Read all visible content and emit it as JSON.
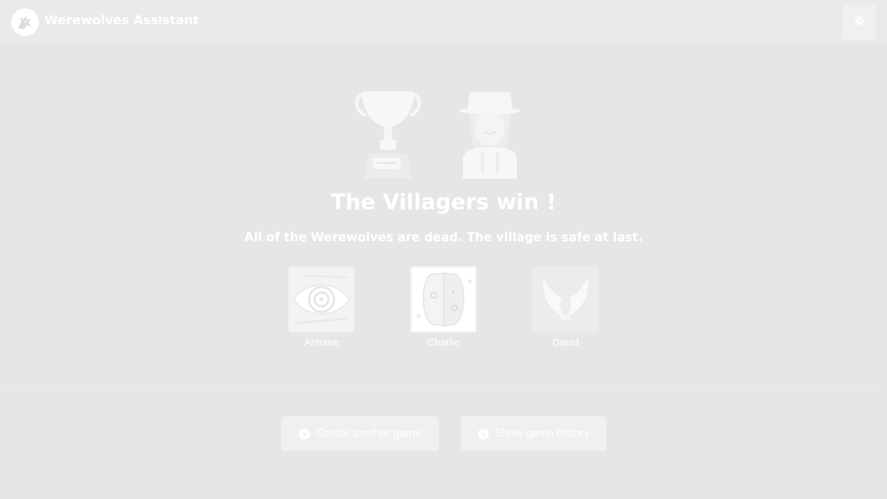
{
  "app": {
    "title": "Werewolves Assistant",
    "logo_icon": "werewolf-head-icon",
    "settings_icon": "gear-icon"
  },
  "result": {
    "trophy_icon": "trophy-icon",
    "winner_icon": "villager-icon",
    "title": "The Villagers win !",
    "subtitle": "All of the Werewolves are dead. The village is safe at last."
  },
  "players": [
    {
      "name": "Antoine",
      "role_icon": "seer-eye-icon"
    },
    {
      "name": "Charlie",
      "role_icon": "two-faced-mask-icon"
    },
    {
      "name": "David",
      "role_icon": "angel-wings-icon"
    }
  ],
  "actions": {
    "create_label": "Create another game",
    "create_icon": "play-circle-icon",
    "history_label": "Show game history",
    "history_icon": "clock-icon"
  },
  "colors": {
    "background": "#e6e6e6",
    "foreground": "#ffffff",
    "button": "#f0f0f0"
  }
}
